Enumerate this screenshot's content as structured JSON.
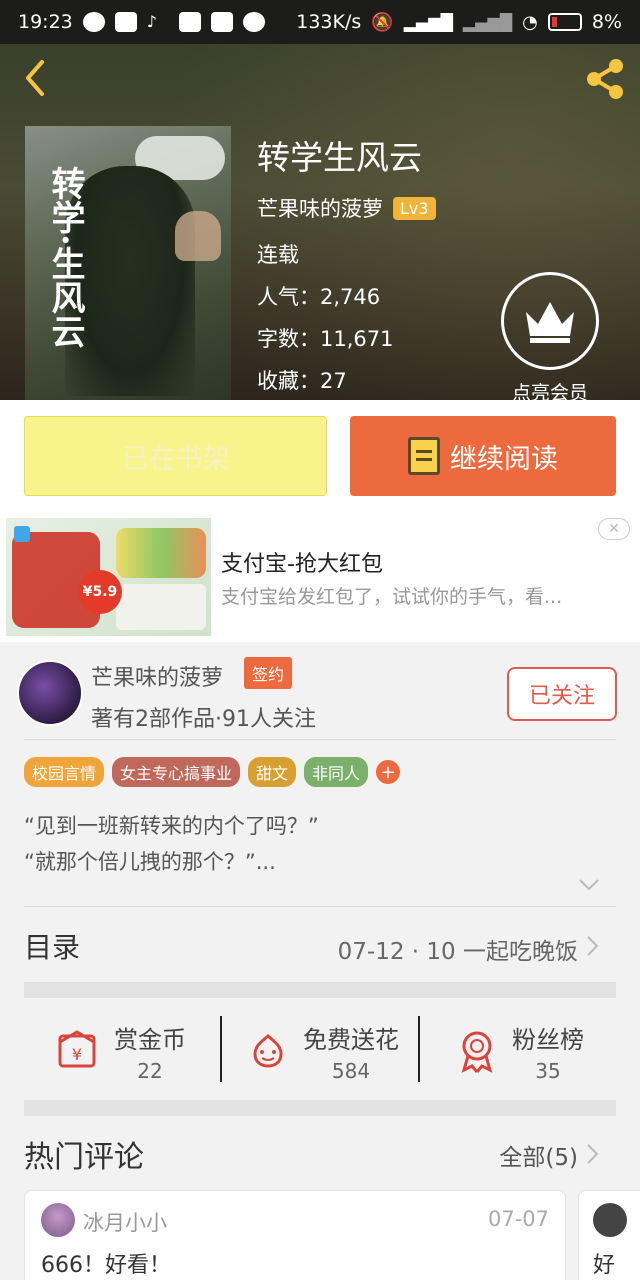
{
  "status_bar": {
    "time": "19:23",
    "network_speed": "133K/s",
    "battery": "8%"
  },
  "book": {
    "title": "转学生风云",
    "cover_title": "转学·生风云",
    "author": "芒果味的菠萝",
    "level": "Lv3",
    "status": "连载",
    "popularity_label": "人气：2,746",
    "word_count_label": "字数：11,671",
    "favorites_label": "收藏：27"
  },
  "vip": {
    "label": "点亮会员"
  },
  "actions": {
    "shelf_label": "已在书架",
    "read_label": "继续阅读"
  },
  "ad": {
    "title": "支付宝-抢大红包",
    "desc": "支付宝给发红包了，试试你的手气，看...",
    "price": "¥5.9"
  },
  "author_box": {
    "name": "芒果味的菠萝",
    "sign_badge": "签约",
    "meta": "著有2部作品·91人关注",
    "follow_label": "已关注"
  },
  "tags": [
    {
      "label": "校园言情",
      "color": "#f0a53a"
    },
    {
      "label": "女主专心搞事业",
      "color": "#c0685a"
    },
    {
      "label": "甜文",
      "color": "#d8a030"
    },
    {
      "label": "非同人",
      "color": "#7ab06a"
    }
  ],
  "intro": {
    "line1": "“见到一班新转来的内个了吗？”",
    "line2": "“就那个倍儿拽的那个？”..."
  },
  "catalog": {
    "label": "目录",
    "latest": "07-12 · 10   一起吃晚饭"
  },
  "stats": [
    {
      "label": "赏金币",
      "value": "22",
      "icon": "coin-envelope-icon"
    },
    {
      "label": "免费送花",
      "value": "584",
      "icon": "flower-icon"
    },
    {
      "label": "粉丝榜",
      "value": "35",
      "icon": "medal-icon"
    }
  ],
  "hot_comments": {
    "title": "热门评论",
    "all_label": "全部(5)",
    "items": [
      {
        "name": "冰月小小",
        "date": "07-07",
        "text": "666！好看！"
      },
      {
        "text": "好"
      }
    ]
  },
  "colors": {
    "accent": "#ec6a3d",
    "shelf_button": "#f8f38a",
    "follow_border": "#e35a4a"
  }
}
